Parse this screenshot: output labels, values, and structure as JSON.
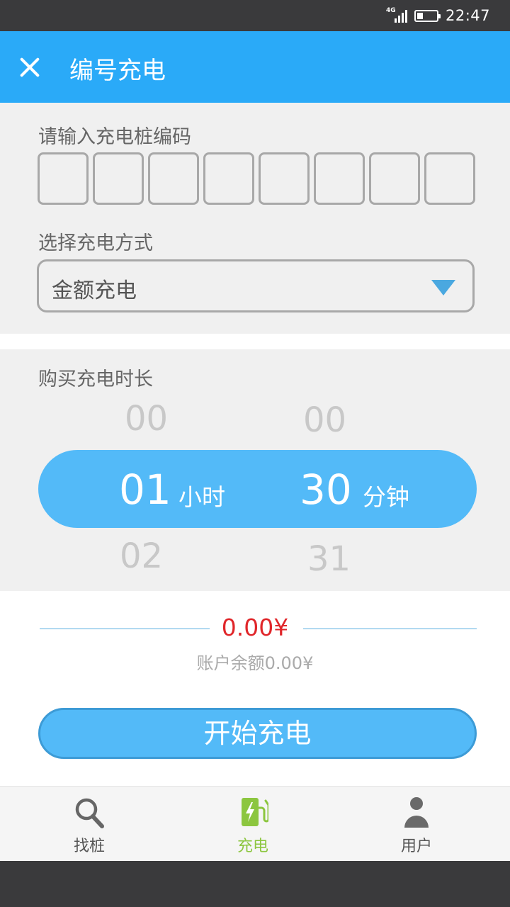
{
  "status_bar": {
    "network": "4G",
    "time": "22:47",
    "battery_percent": 30
  },
  "app_bar": {
    "title": "编号充电"
  },
  "form": {
    "code_label": "请输入充电桩编码",
    "code_digits": [
      "",
      "",
      "",
      "",
      "",
      "",
      "",
      ""
    ],
    "method_label": "选择充电方式",
    "method_value": "金额充电"
  },
  "duration": {
    "label": "购买充电时长",
    "hours_prev": "00",
    "hours_selected": "01",
    "hours_next": "02",
    "hours_unit": "小时",
    "minutes_prev": "00",
    "minutes_selected": "30",
    "minutes_next": "31",
    "minutes_unit": "分钟"
  },
  "payment": {
    "price": "0.00¥",
    "balance": "账户余额0.00¥",
    "start_button": "开始充电"
  },
  "nav": {
    "items": [
      {
        "label": "找桩",
        "icon": "search-icon"
      },
      {
        "label": "充电",
        "icon": "charging-station-icon",
        "active": true
      },
      {
        "label": "用户",
        "icon": "user-icon"
      }
    ]
  },
  "colors": {
    "primary": "#2aaaf8",
    "picker": "#53baf8",
    "accent_green": "#8cc63f",
    "price_red": "#e0262a"
  }
}
